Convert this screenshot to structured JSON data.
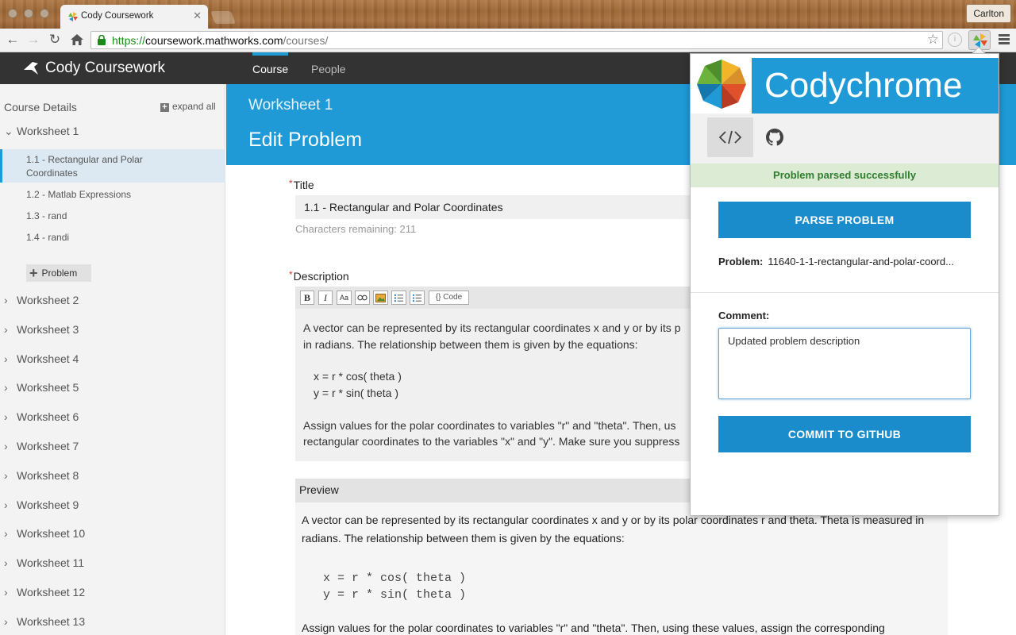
{
  "browser": {
    "tab_title": "Cody Coursework",
    "profile_name": "Carlton",
    "url_scheme": "https://",
    "url_host": "coursework.mathworks.com",
    "url_path": "/courses/"
  },
  "app": {
    "brand": "Cody Coursework",
    "nav": [
      "Course",
      "People"
    ]
  },
  "sidebar": {
    "title": "Course Details",
    "expand_all": "expand all",
    "open_worksheet": "Worksheet 1",
    "problems": [
      "1.1 - Rectangular and Polar Coordinates",
      "1.2 - Matlab Expressions",
      "1.3 - rand",
      "1.4 - randi"
    ],
    "problem_1_line1": "1.1 - Rectangular and Polar",
    "problem_1_line2": "Coordinates",
    "add_problem": "Problem",
    "worksheets": [
      "Worksheet 2",
      "Worksheet 3",
      "Worksheet 4",
      "Worksheet 5",
      "Worksheet 6",
      "Worksheet 7",
      "Worksheet 8",
      "Worksheet 9",
      "Worksheet 10",
      "Worksheet 11",
      "Worksheet 12",
      "Worksheet 13"
    ]
  },
  "main": {
    "worksheet": "Worksheet 1",
    "page_title": "Edit Problem",
    "title_label": "Title",
    "title_value": "1.1 - Rectangular and Polar Coordinates",
    "chars_remaining": "Characters remaining: 211",
    "description_label": "Description",
    "editor_buttons": [
      "B",
      "I",
      "Aa",
      "Link",
      "Image",
      "Bulleted list",
      "Numbered list",
      "{} Code"
    ],
    "editor_lines": [
      "A vector can be represented by its rectangular coordinates x and y or by its p",
      "in radians. The relationship between them is given by the equations:",
      "x = r * cos( theta )",
      "y = r * sin( theta )",
      "Assign values for the polar coordinates to variables \"r\" and \"theta\". Then, us",
      "rectangular coordinates to the variables \"x\" and \"y\". Make sure you suppress"
    ],
    "preview_label": "Preview",
    "preview_lines": [
      "A vector can be represented by its rectangular coordinates x and y or by its polar coordinates r and theta. Theta is measured in",
      "radians. The relationship between them is given by the equations:",
      "x = r * cos( theta )",
      "y = r * sin( theta )",
      "Assign values for the polar coordinates to variables \"r\" and \"theta\". Then, using these values, assign the corresponding"
    ]
  },
  "popup": {
    "brand": "Codychrome",
    "status": "Problem parsed successfully",
    "parse_button": "PARSE PROBLEM",
    "problem_label": "Problem:",
    "problem_value": "11640-1-1-rectangular-and-polar-coord...",
    "comment_label": "Comment:",
    "comment_value": "Updated problem description",
    "commit_button": "COMMIT TO GITHUB",
    "status_color": "#dcebd4",
    "accent": "#1a8ccc"
  },
  "colors": {
    "brand_blue": "#1f9ad6",
    "appbar": "#333333"
  }
}
